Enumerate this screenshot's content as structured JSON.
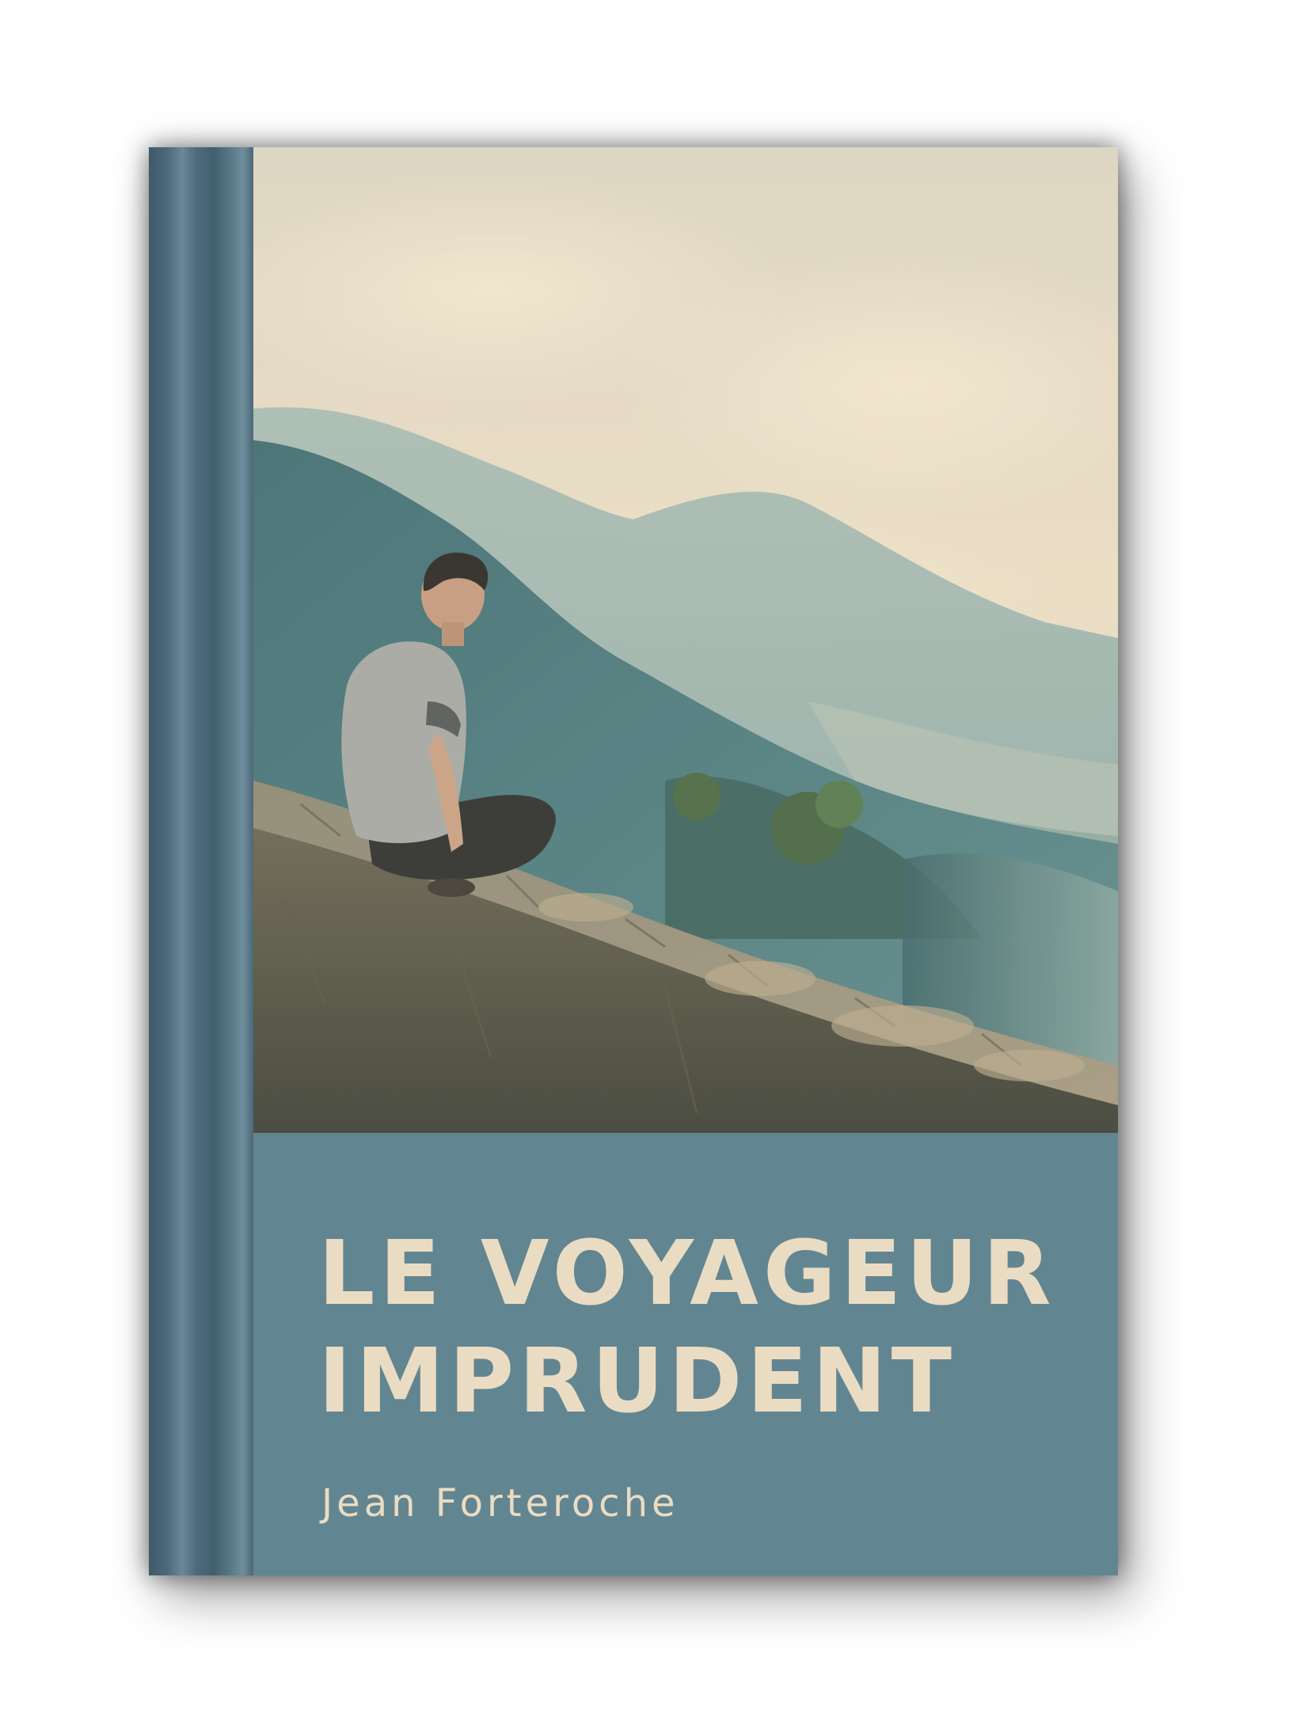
{
  "cover": {
    "title_line1": "LE VOYAGEUR",
    "title_line2": "IMPRUDENT",
    "author": "Jean Forteroche"
  },
  "colors": {
    "spine": "#4c6a7b",
    "title_panel": "#628592",
    "title_text": "#eadcc2",
    "sky": "#e6dac3",
    "mountain": "#5f8a8f"
  }
}
